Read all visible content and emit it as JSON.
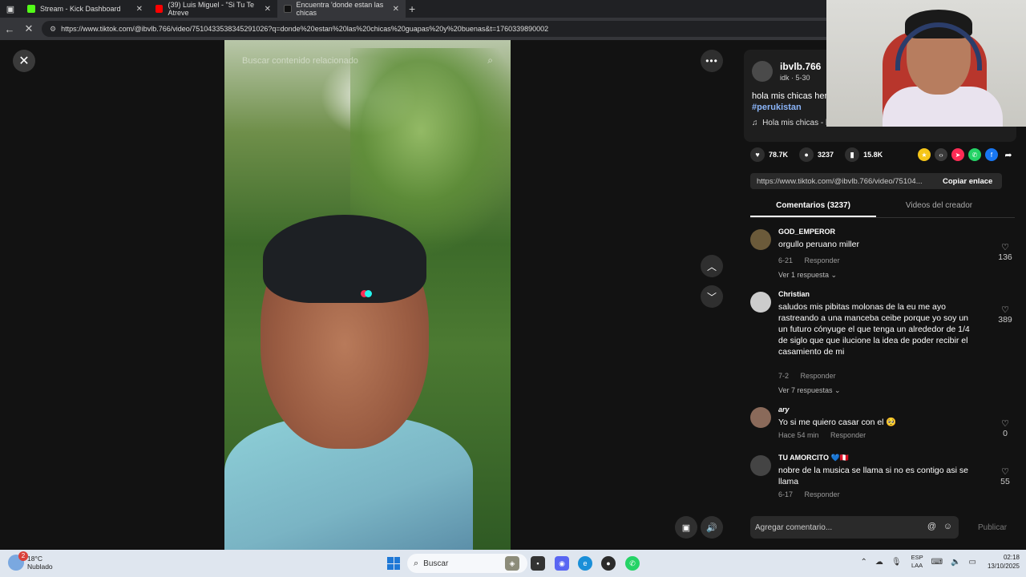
{
  "browser": {
    "tabs": [
      {
        "label": "Stream - Kick Dashboard",
        "active": false,
        "color": "#53fc18"
      },
      {
        "label": "(39) Luis Miguel - \"Si Tu Te Atreve",
        "active": false,
        "color": "#ff0000"
      },
      {
        "label": "Encuentra 'donde estan las chicas",
        "active": true,
        "color": "#000000"
      }
    ],
    "url": "https://www.tiktok.com/@ibvlb.766/video/7510433538345291026?q=donde%20estan%20las%20chicas%20guapas%20y%20buenas&t=1760339890002"
  },
  "video": {
    "search_placeholder": "Buscar contenido relacionado"
  },
  "creator": {
    "username": "ibvlb.766",
    "subtitle": "idk · 5-30",
    "description": "hola mis chicas her",
    "hashtag": "#perukistan",
    "music": "Hola mis chicas - l"
  },
  "actions": {
    "likes": "78.7K",
    "comments": "3237",
    "saves": "15.8K"
  },
  "share": {
    "link": "https://www.tiktok.com/@ibvlb.766/video/75104...",
    "copy_label": "Copiar enlace"
  },
  "comment_tabs": {
    "comments": "Comentarios (3237)",
    "creator_videos": "Videos del creador"
  },
  "comments": [
    {
      "name": "GOD_EMPEROR",
      "text": "orgullo peruano miller",
      "date": "6-21",
      "reply": "Responder",
      "likes": "136",
      "more": "Ver 1 respuesta"
    },
    {
      "name": "Christian",
      "text": "saludos mis pibitas molonas de la eu me ayo rastreando a una manceba ceibe porque yo soy un un futuro cónyuge el que tenga un alrededor de 1/4 de siglo que que ilucione la idea de poder recibir el casamiento de mi",
      "date": "7-2",
      "reply": "Responder",
      "likes": "389",
      "more": "Ver 7 respuestas"
    },
    {
      "name": "ary",
      "text": "Yo si me quiero casar con el 🥺",
      "date": "Hace 54 min",
      "reply": "Responder",
      "likes": "0",
      "more": ""
    },
    {
      "name": "TU AMORCITO 💙🇵🇪",
      "text": "nobre de la musica se llama si no es contigo asi se llama",
      "date": "6-17",
      "reply": "Responder",
      "likes": "55",
      "more": ""
    }
  ],
  "comment_input": {
    "placeholder": "Agregar comentario...",
    "publish": "Publicar"
  },
  "taskbar": {
    "weather_badge": "2",
    "temperature": "18°C",
    "condition": "Nublado",
    "search": "Buscar",
    "lang_top": "ESP",
    "lang_bottom": "LAA",
    "time": "02:18",
    "date": "13/10/2025"
  }
}
